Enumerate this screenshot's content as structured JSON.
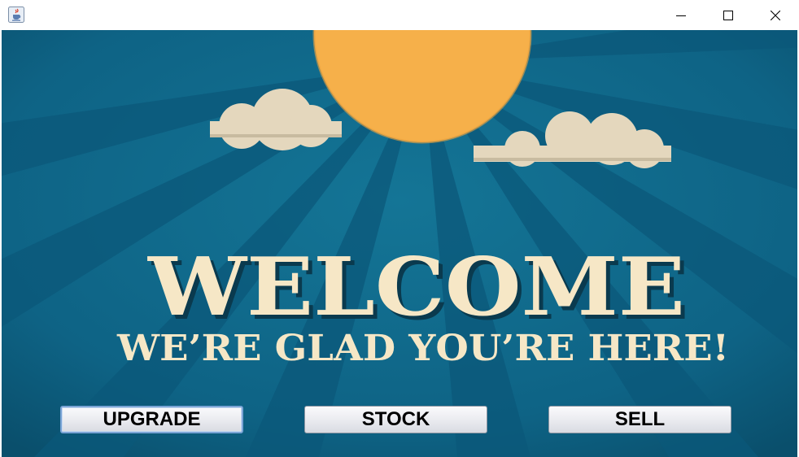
{
  "window": {
    "app_icon": "java-cup-icon",
    "controls": {
      "minimize": "minimize-icon",
      "maximize": "maximize-icon",
      "close": "close-icon"
    }
  },
  "banner": {
    "headline": "WELCOME",
    "subheadline": "WE’RE GLAD YOU’RE HERE!",
    "colors": {
      "background": "#0e6385",
      "sun": "#f6b04a",
      "text": "#f6e7c6",
      "clouds": "#e4d7bd"
    }
  },
  "buttons": {
    "upgrade": "UPGRADE",
    "stock": "STOCK",
    "sell": "SELL"
  }
}
